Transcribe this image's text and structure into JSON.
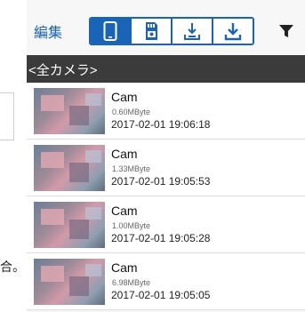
{
  "left_text": "合。",
  "toolbar": {
    "edit_label": "編集",
    "segments": [
      {
        "name": "phone-icon",
        "active": true
      },
      {
        "name": "sd-card-icon",
        "active": false
      },
      {
        "name": "download-to-device-icon",
        "active": false
      },
      {
        "name": "download-icon",
        "active": false
      }
    ],
    "filter_icon": "filter-icon"
  },
  "folder": {
    "title": "<全カメラ>"
  },
  "files": [
    {
      "name": "Cam",
      "size": "0.60MByte",
      "date": "2017-02-01 19:06:18"
    },
    {
      "name": "Cam",
      "size": "1.33MByte",
      "date": "2017-02-01 19:05:53"
    },
    {
      "name": "Cam",
      "size": "1.00MByte",
      "date": "2017-02-01 19:05:28"
    },
    {
      "name": "Cam",
      "size": "6.98MByte",
      "date": "2017-02-01 19:05:05"
    }
  ],
  "colors": {
    "accent": "#1a64b8",
    "header_bar": "#3b3b3b"
  }
}
